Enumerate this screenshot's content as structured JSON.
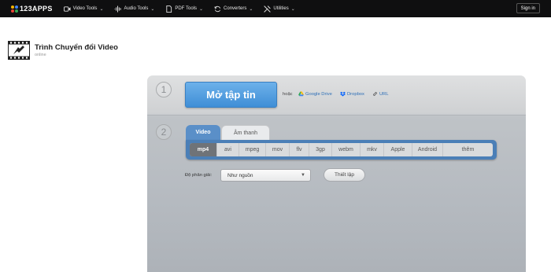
{
  "topbar": {
    "logo_text": "123APPS",
    "nav": [
      {
        "label": "Video Tools",
        "icon": "video-icon"
      },
      {
        "label": "Audio Tools",
        "icon": "audio-wave-icon"
      },
      {
        "label": "PDF Tools",
        "icon": "pdf-icon"
      },
      {
        "label": "Converters",
        "icon": "convert-icon"
      },
      {
        "label": "Utilities",
        "icon": "tools-icon"
      }
    ],
    "sign_in": "Sign in"
  },
  "app": {
    "title": "Trình Chuyển đổi Video",
    "subtitle": "online",
    "icon": "video-converter-icon"
  },
  "step1": {
    "number": "1",
    "open_button": "Mở tập tin",
    "or_text": "hoặc",
    "sources": [
      {
        "label": "Google Drive",
        "icon": "google-drive-icon"
      },
      {
        "label": "Dropbox",
        "icon": "dropbox-icon"
      },
      {
        "label": "URL",
        "icon": "link-icon"
      }
    ]
  },
  "step2": {
    "number": "2",
    "tabs": [
      "Video",
      "Âm thanh"
    ],
    "active_tab": "Video",
    "formats": [
      "mp4",
      "avi",
      "mpeg",
      "mov",
      "flv",
      "3gp",
      "webm",
      "mkv",
      "Apple",
      "Android",
      "thêm"
    ],
    "selected_format": "mp4",
    "resolution_label": "Độ phân giải:",
    "resolution_value": "Như nguồn",
    "settings_button": "Thiết lập"
  },
  "colors": {
    "topbar": "#0f0f10",
    "accent_blue": "#3f8ed6",
    "format_bar": "#4b7fb7",
    "selected_format": "#6f7378"
  }
}
